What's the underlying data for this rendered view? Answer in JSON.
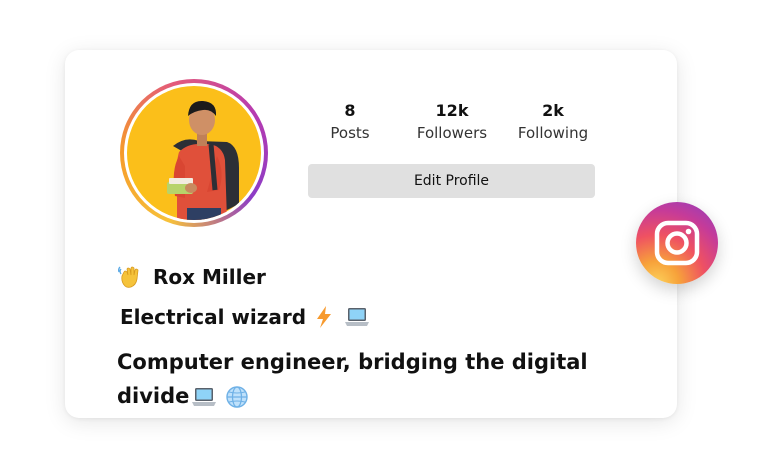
{
  "profile": {
    "name": "Rox Miller",
    "bio_line1": "Electrical wizard",
    "bio_line2_a": "Computer engineer, bridging the digital",
    "bio_line2_b": "divide"
  },
  "stats": [
    {
      "value": "8",
      "label": "Posts"
    },
    {
      "value": "12k",
      "label": "Followers"
    },
    {
      "value": "2k",
      "label": "Following"
    }
  ],
  "actions": {
    "edit_profile": "Edit Profile"
  },
  "icons": [
    "waving-hand-icon",
    "lightning-icon",
    "laptop-icon",
    "globe-icon",
    "instagram-icon"
  ],
  "colors": {
    "avatar_background": "#fbbf1a",
    "button_background": "#e0e0e0",
    "instagram_gradient": [
      "#fdd35c",
      "#ef5162",
      "#c63b98",
      "#8a3ec4"
    ]
  }
}
